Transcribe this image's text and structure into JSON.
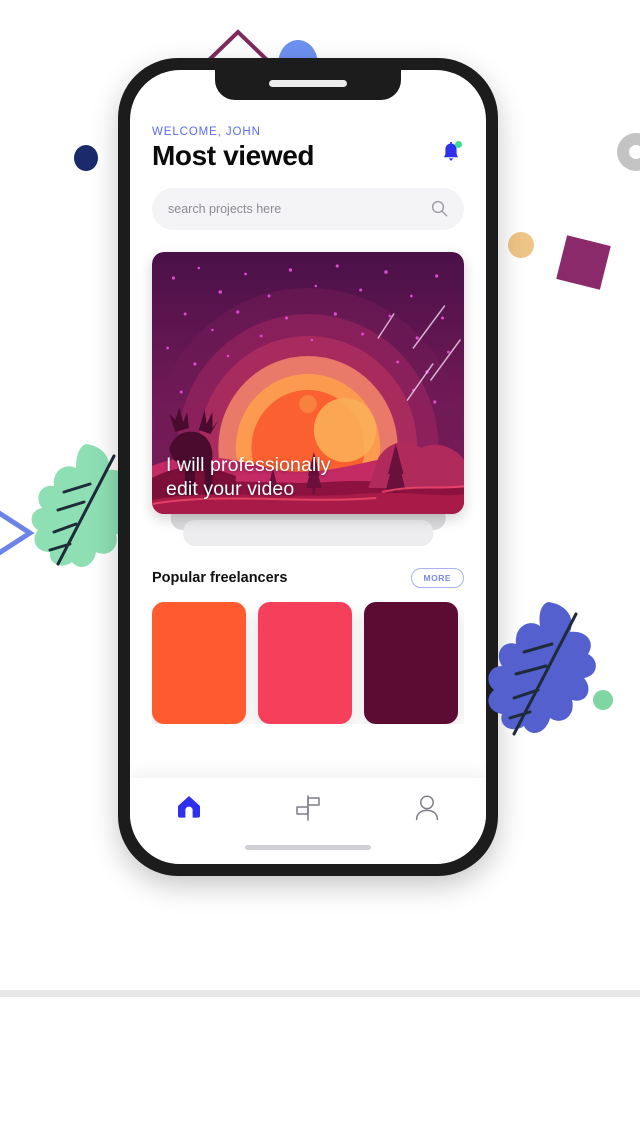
{
  "app": {
    "welcome": "WELCOME, JOHN",
    "title": "Most viewed",
    "bell_icon": "notification-bell-icon",
    "badge_color": "#3DE08A"
  },
  "search": {
    "placeholder": "search projects here",
    "icon": "search-icon"
  },
  "hero": {
    "caption_line1": "I will professionally",
    "caption_line2": "edit your video",
    "illustration": "sunset-landscape-with-deer-illustration"
  },
  "section": {
    "title": "Popular freelancers",
    "more_label": "MORE"
  },
  "freelancer_cards": [
    {
      "name": "freelancer-card-1",
      "color": "#FF5B2E"
    },
    {
      "name": "freelancer-card-2",
      "color": "#F53F5B"
    },
    {
      "name": "freelancer-card-3",
      "color": "#5C0B33"
    },
    {
      "name": "freelancer-card-4",
      "color": "#3A42EE"
    }
  ],
  "nav": [
    {
      "name": "nav-home",
      "icon": "home-icon",
      "active": true
    },
    {
      "name": "nav-explore",
      "icon": "signpost-icon",
      "active": false
    },
    {
      "name": "nav-profile",
      "icon": "person-icon",
      "active": false
    }
  ],
  "decorations": {
    "triangle_color": "#7E2A5E",
    "blue_semicircle": "#6D91F0",
    "navy_dot": "#1B2A6B",
    "tan_dot": "#EFC487",
    "maroon_square": "#8A2A6B",
    "gray_ring": "#C3C3C3",
    "green_dot": "#7FD6A2",
    "chevron": "#6C83E8",
    "leaf_green": "#8EE0B4",
    "leaf_blue": "#5360CE"
  }
}
